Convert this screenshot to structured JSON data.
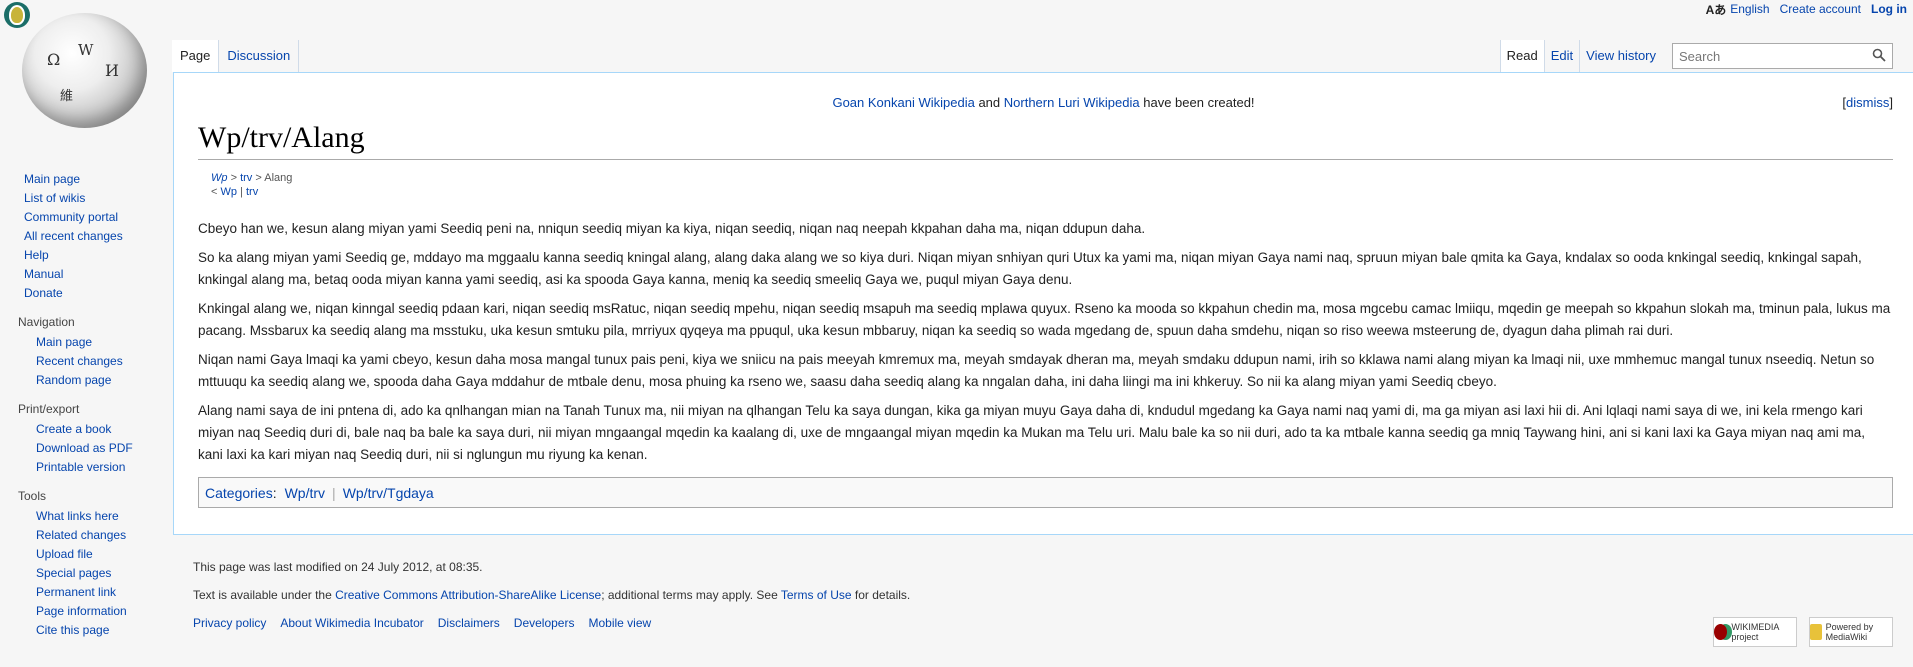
{
  "personal": {
    "language_glyph": "Aあ",
    "language": "English",
    "create_account": "Create account",
    "log_in": "Log in"
  },
  "logo": {
    "glyphs": [
      "Ω",
      "W",
      "И",
      "維"
    ]
  },
  "sidebar": {
    "main": [
      "Main page",
      "List of wikis",
      "Community portal",
      "All recent changes",
      "Help",
      "Manual",
      "Donate"
    ],
    "navigation": {
      "heading": "Navigation",
      "items": [
        "Main page",
        "Recent changes",
        "Random page"
      ]
    },
    "print": {
      "heading": "Print/export",
      "items": [
        "Create a book",
        "Download as PDF",
        "Printable version"
      ]
    },
    "tools": {
      "heading": "Tools",
      "items": [
        "What links here",
        "Related changes",
        "Upload file",
        "Special pages",
        "Permanent link",
        "Page information",
        "Cite this page"
      ]
    }
  },
  "tabs": {
    "page": "Page",
    "discussion": "Discussion",
    "read": "Read",
    "edit": "Edit",
    "history": "View history"
  },
  "search": {
    "placeholder": "Search"
  },
  "notice": {
    "link1": "Goan Konkani Wikipedia",
    "and": "and",
    "link2": "Northern Luri Wikipedia",
    "rest": "have been created!",
    "dismiss": "dismiss"
  },
  "title": "Wp/trv/Alang",
  "breadcrumb": {
    "line1": {
      "wp": "Wp",
      "sep1": ">",
      "trv": "trv",
      "sep2": ">",
      "current": "Alang"
    },
    "line2": {
      "prefix": "<",
      "wp": "Wp",
      "sep": "|",
      "trv": "trv"
    }
  },
  "paragraphs": [
    "Cbeyo han we, kesun alang miyan yami Seediq peni na, nniqun seediq miyan ka kiya, niqan seediq, niqan naq neepah kkpahan daha ma, niqan ddupun daha.",
    "So ka alang miyan yami Seediq ge, mddayo ma mggaalu kanna seediq kningal alang, alang daka alang we so kiya duri. Niqan miyan snhiyan quri Utux ka yami ma, niqan miyan Gaya nami naq, spruun miyan bale qmita ka Gaya, kndalax so ooda knkingal seediq, knkingal sapah, knkingal alang ma, betaq ooda miyan kanna yami seediq, asi ka spooda Gaya kanna, meniq ka seediq smeeliq Gaya we, puqul miyan Gaya denu.",
    "Knkingal alang we, niqan kinngal seediq pdaan kari, niqan seediq msRatuc, niqan seediq mpehu, niqan seediq msapuh ma seediq mplawa quyux. Rseno ka mooda so kkpahun chedin ma, mosa mgcebu camac lmiiqu, mqedin ge meepah so kkpahun slokah ma, tminun pala, lukus ma pacang. Mssbarux ka seediq alang ma msstuku, uka kesun smtuku pila, mrriyux qyqeya ma ppuqul, uka kesun mbbaruy, niqan ka seediq so wada mgedang de, spuun daha smdehu, niqan so riso weewa msteerung de, dyagun daha plimah rai duri.",
    "Niqan nami Gaya lmaqi ka yami cbeyo, kesun daha mosa mangal tunux pais peni, kiya we sniicu na pais meeyah kmremux ma, meyah smdayak dheran ma, meyah smdaku ddupun nami, irih so kklawa nami alang miyan ka lmaqi nii, uxe mmhemuc mangal tunux nseediq. Netun so mttuuqu ka seediq alang we, spooda daha Gaya mddahur de mtbale denu, mosa phuing ka rseno we, saasu daha seediq alang ka nngalan daha, ini daha liingi ma ini khkeruy. So nii ka alang miyan yami Seediq cbeyo.",
    "Alang nami saya de ini pntena di, ado ka qnlhangan mian na Tanah Tunux ma, nii miyan na qlhangan Telu ka saya dungan, kika ga miyan muyu Gaya daha di, kndudul mgedang ka Gaya nami naq yami di, ma ga miyan asi laxi hii di. Ani lqlaqi nami saya di we, ini kela rmengo kari miyan naq Seediq duri di, bale naq ba bale ka saya duri, nii miyan mngaangal mqedin ka kaalang di, uxe de mngaangal miyan mqedin ka Mukan ma Telu uri. Malu bale ka so nii duri, ado ta ka mtbale kanna seediq ga mniq Taywang hini, ani si kani laxi ka Gaya miyan naq ami ma, kani laxi ka kari miyan naq Seediq duri, nii si nglungun mu riyung ka kenan."
  ],
  "categories": {
    "label": "Categories",
    "colon": ":",
    "items": [
      "Wp/trv",
      "Wp/trv/Tgdaya"
    ]
  },
  "footer": {
    "lastmod": "This page was last modified on 24 July 2012, at 08:35.",
    "license_pre": "Text is available under the ",
    "license_link": "Creative Commons Attribution-ShareAlike License",
    "license_mid": "; additional terms may apply. See ",
    "terms_link": "Terms of Use",
    "license_post": " for details.",
    "places": [
      "Privacy policy",
      "About Wikimedia Incubator",
      "Disclaimers",
      "Developers",
      "Mobile view"
    ],
    "badge_wikimedia": "WIKIMEDIA project",
    "badge_mediawiki": "Powered by MediaWiki"
  }
}
